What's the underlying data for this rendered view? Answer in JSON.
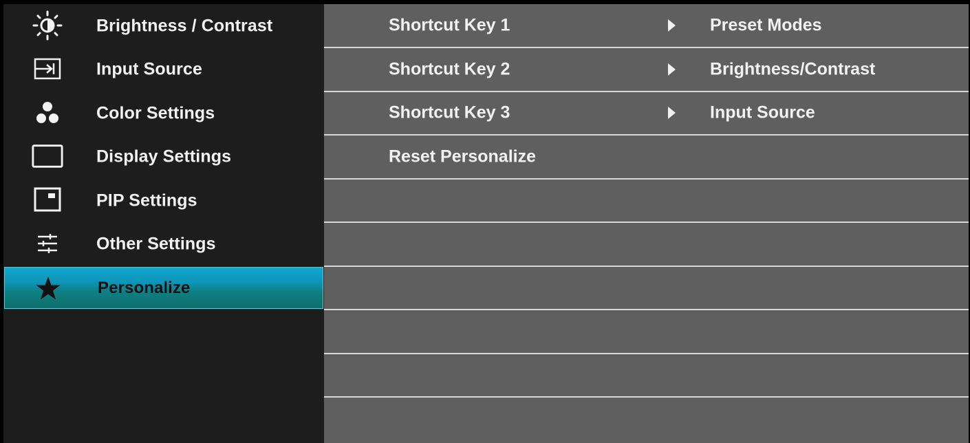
{
  "sidebar": {
    "items": [
      {
        "label": "Brightness / Contrast",
        "icon": "brightness-icon",
        "selected": false
      },
      {
        "label": "Input Source",
        "icon": "input-source-icon",
        "selected": false
      },
      {
        "label": "Color Settings",
        "icon": "color-settings-icon",
        "selected": false
      },
      {
        "label": "Display Settings",
        "icon": "display-settings-icon",
        "selected": false
      },
      {
        "label": "PIP Settings",
        "icon": "pip-settings-icon",
        "selected": false
      },
      {
        "label": "Other Settings",
        "icon": "other-settings-icon",
        "selected": false
      },
      {
        "label": "Personalize",
        "icon": "star-icon",
        "selected": true
      }
    ]
  },
  "main": {
    "rows": [
      {
        "label": "Shortcut Key 1",
        "value": "Preset Modes",
        "icon": "arrow-right-icon"
      },
      {
        "label": "Shortcut Key 2",
        "value": "Brightness/Contrast",
        "icon": "arrow-right-icon"
      },
      {
        "label": "Shortcut Key 3",
        "value": "Input Source",
        "icon": "arrow-right-icon"
      },
      {
        "label": "Reset Personalize",
        "value": ""
      },
      {
        "label": "",
        "value": ""
      },
      {
        "label": "",
        "value": ""
      },
      {
        "label": "",
        "value": ""
      },
      {
        "label": "",
        "value": ""
      },
      {
        "label": "",
        "value": ""
      }
    ]
  },
  "colors": {
    "sidebar_bg": "#1d1d1d",
    "content_bg": "#5f5f5f",
    "selected_top": "#14a6cf",
    "selected_bottom": "#0d6f6b",
    "divider": "#d8d8d8",
    "text": "#f2f2f2"
  }
}
